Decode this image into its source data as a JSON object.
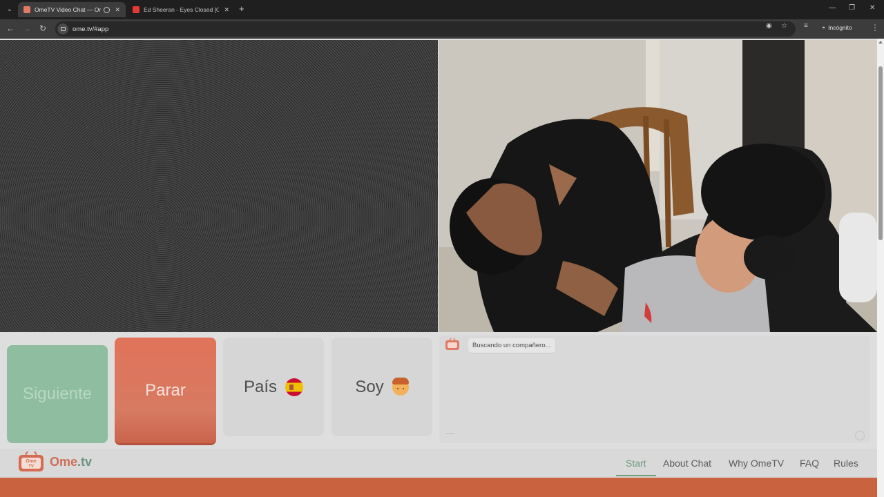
{
  "browser": {
    "tabs": [
      {
        "title": "OmeTV Video Chat — Ome",
        "favicon_color": "#e07a64",
        "active": true
      },
      {
        "title": "Ed Sheeran - Eyes Closed [Offic",
        "favicon_color": "#e53935",
        "active": false
      }
    ],
    "url": "ome.tv/#app",
    "profile_label": "Incógnito"
  },
  "controls": {
    "next_label": "Siguiente",
    "stop_label": "Parar",
    "country_label": "País",
    "gender_label": "Soy"
  },
  "chat": {
    "status_message": "Buscando un compañero..."
  },
  "footer": {
    "brand_prefix": "Ome",
    "brand_suffix": ".tv",
    "logo_top": "Ome",
    "logo_bottom": "TV",
    "nav": [
      "Start",
      "About Chat",
      "Why OmeTV",
      "FAQ",
      "Rules"
    ],
    "active_nav": "Start"
  },
  "colors": {
    "accent": "#cd6d55",
    "green": "#6e9a7c",
    "stop_button": "#d77a62",
    "next_button": "#8ebd9f"
  }
}
